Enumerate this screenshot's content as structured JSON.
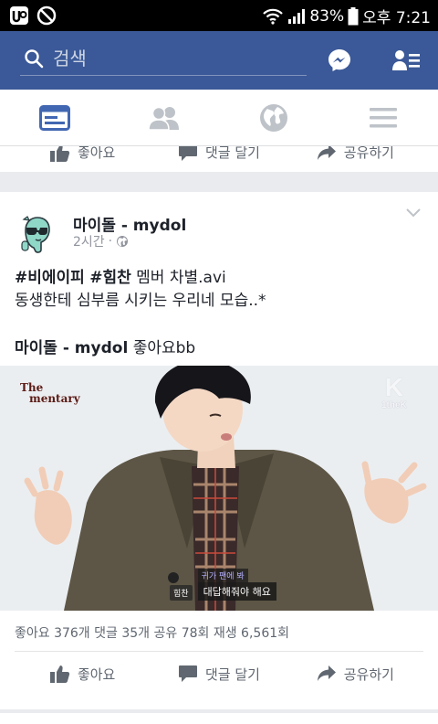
{
  "status_bar": {
    "battery": "83%",
    "time": "오후 7:21"
  },
  "search": {
    "placeholder": "검색"
  },
  "post": {
    "page_name": "마이돌 - mydol",
    "time": "2시간",
    "hashtag1": "#비에이피",
    "hashtag2": "#힘찬",
    "line1_rest": " 멤버 차별.avi",
    "line2": "동생한테 심부름 시키는 우리네 모습..*",
    "shared_name": "마이돌 - mydol",
    "shared_text": " 좋아요bb",
    "video": {
      "logo_left_1": "The",
      "logo_left_2": "mentary",
      "logo_right_1": "K",
      "logo_right_2": "1theK",
      "subtitle_speaker": "힘찬",
      "subtitle_top": "귀가 팬에 봐",
      "subtitle_main": "대답해줘야 해요"
    },
    "stats": "좋아요 376개  댓글 35개  공유 78회  재생 6,561회"
  },
  "actions": {
    "like": "좋아요",
    "comment": "댓글 달기",
    "share": "공유하기"
  },
  "colors": {
    "brand": "#3b5998",
    "tab_active": "#4267b2",
    "tab_inactive": "#bec3c9"
  }
}
